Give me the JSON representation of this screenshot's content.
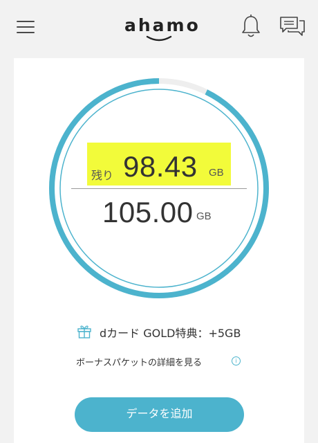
{
  "header": {
    "logo_text": "ahamo",
    "icons": {
      "menu": "hamburger-menu-icon",
      "notification": "bell-icon",
      "chat": "chat-bubbles-icon"
    }
  },
  "usage": {
    "remaining_label": "残り",
    "remaining_value": "98.43",
    "remaining_unit": "GB",
    "total_value": "105.00",
    "total_unit": "GB",
    "remaining_fraction": 0.9374
  },
  "bonus": {
    "icon": "gift-icon",
    "label": "dカード GOLD特典：+5GB"
  },
  "detail_link": {
    "label": "ボーナスパケットの詳細を見る",
    "info_icon": "info-icon",
    "info_glyph": "i"
  },
  "actions": {
    "add_data_label": "データを追加"
  },
  "colors": {
    "accent": "#4cb3cd",
    "highlight": "#f2fb3a",
    "track": "#eeeeee",
    "background": "#f2f2f2"
  }
}
